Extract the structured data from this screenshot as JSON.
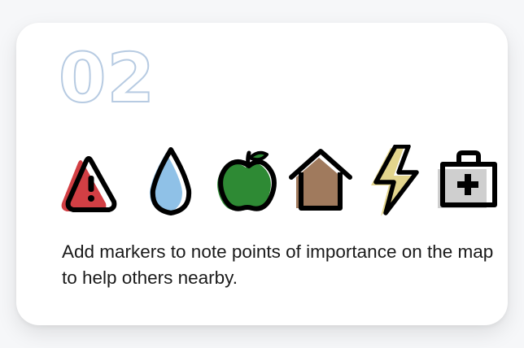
{
  "card": {
    "step_number": "02",
    "description": "Add markers to note points of importance on the map to help others nearby."
  },
  "icons": [
    {
      "name": "warning-icon",
      "color": "#d23f44"
    },
    {
      "name": "water-drop-icon",
      "color": "#8fc1e7"
    },
    {
      "name": "apple-icon",
      "color": "#2e8a34"
    },
    {
      "name": "house-icon",
      "color": "#a07a5d"
    },
    {
      "name": "lightning-icon",
      "color": "#e3d58d"
    },
    {
      "name": "first-aid-kit-icon",
      "color": "#cfcfcf"
    }
  ]
}
